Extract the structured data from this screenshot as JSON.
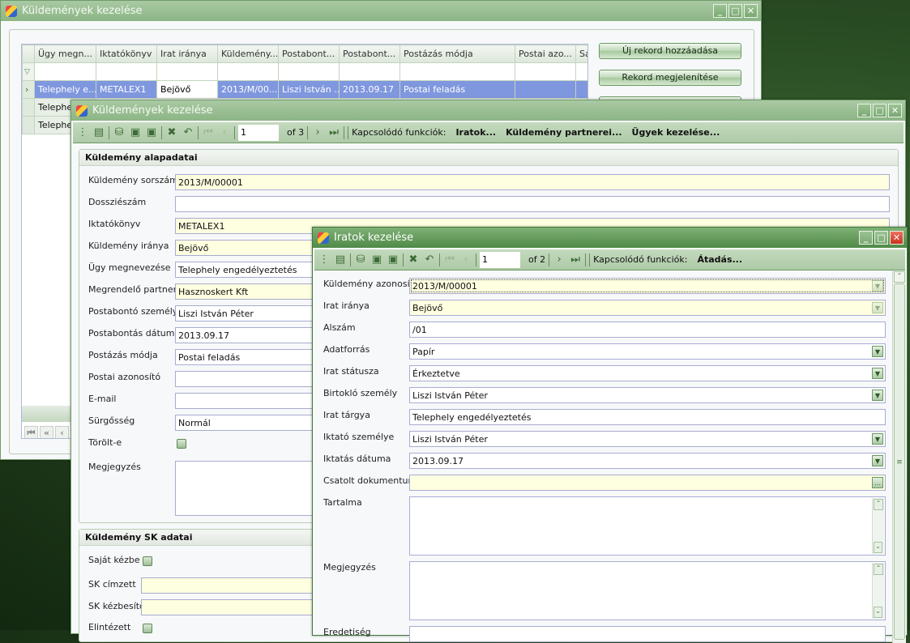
{
  "win1": {
    "title": "Küldemények kezelése",
    "grid": {
      "columns": [
        "Ügy megn...",
        "Iktatókönyv",
        "Irat iránya",
        "Küldemény...",
        "Postabont...",
        "Postabont...",
        "Postázás módja",
        "Postai azo...",
        "Sa"
      ],
      "rows": [
        [
          "Telephely e...",
          "METALEX1",
          "Bejövő",
          "2013/M/00...",
          "Liszi István ...",
          "2013.09.17",
          "Postai feladás",
          "",
          ""
        ],
        [
          "Telephel"
        ],
        [
          "Telephel"
        ]
      ]
    },
    "buttons": [
      "Új rekord hozzáadása",
      "Rekord megjelenítése"
    ]
  },
  "win2": {
    "title": "Küldemények kezelése",
    "position": "1",
    "of": "of 3",
    "related_label": "Kapcsolódó funkciók:",
    "related": [
      "Iratok...",
      "Küldemény partnerei...",
      "Ügyek kezelése..."
    ],
    "group1": "Küldemény alapadatai",
    "fields": [
      {
        "label": "Küldemény sorszáma",
        "value": "2013/M/00001",
        "req": true
      },
      {
        "label": "Dossziészám",
        "value": ""
      },
      {
        "label": "Iktatókönyv",
        "value": "METALEX1",
        "req": true
      },
      {
        "label": "Küldemény iránya",
        "value": "Bejövő",
        "req": true
      },
      {
        "label": "Ügy megnevezése",
        "value": "Telephely engedélyeztetés"
      },
      {
        "label": "Megrendelő partner",
        "value": "Hasznoskert Kft",
        "req": true
      },
      {
        "label": "Postabontó személye",
        "value": "Liszi István Péter"
      },
      {
        "label": "Postabontás dátuma",
        "value": "2013.09.17"
      },
      {
        "label": "Postázás módja",
        "value": "Postai feladás"
      },
      {
        "label": "Postai azonosító",
        "value": ""
      },
      {
        "label": "E-mail",
        "value": ""
      },
      {
        "label": "Sürgősség",
        "value": "Normál"
      }
    ],
    "deleted_label": "Törölt-e",
    "deleted": false,
    "note_label": "Megjegyzés",
    "group2": "Küldemény SK adatai",
    "own_hand_label": "Saját kézbe",
    "own_hand": false,
    "sk_recipient_label": "SK címzett",
    "sk_deliverer_label": "SK kézbesítő",
    "done_label": "Elintézett",
    "done": false
  },
  "win3": {
    "title": "Iratok kezelése",
    "position": "1",
    "of": "of 2",
    "related_label": "Kapcsolódó funkciók:",
    "related": [
      "Átadás..."
    ],
    "fields": [
      {
        "label": "Küldemény azonosító",
        "value": "2013/M/00001",
        "req": true,
        "dd": "v",
        "dim": true
      },
      {
        "label": "Irat iránya",
        "value": "Bejövő",
        "req": true,
        "dd": "v",
        "dim": true
      },
      {
        "label": "Alszám",
        "value": "/01"
      },
      {
        "label": "Adatforrás",
        "value": "Papír",
        "dd": "v"
      },
      {
        "label": "Irat státusza",
        "value": "Érkeztetve",
        "dd": "v"
      },
      {
        "label": "Birtokló személy",
        "value": "Liszi István Péter",
        "dd": "v"
      },
      {
        "label": "Irat tárgya",
        "value": "Telephely engedélyeztetés"
      },
      {
        "label": "Iktató személye",
        "value": "Liszi István Péter",
        "dd": "v"
      },
      {
        "label": "Iktatás dátuma",
        "value": "2013.09.17",
        "dd": "v"
      },
      {
        "label": "Csatolt dokumentum",
        "value": "",
        "req": true,
        "dd": "..."
      }
    ],
    "content_label": "Tartalma",
    "note_label": "Megjegyzés",
    "origin_label": "Eredetiség"
  }
}
